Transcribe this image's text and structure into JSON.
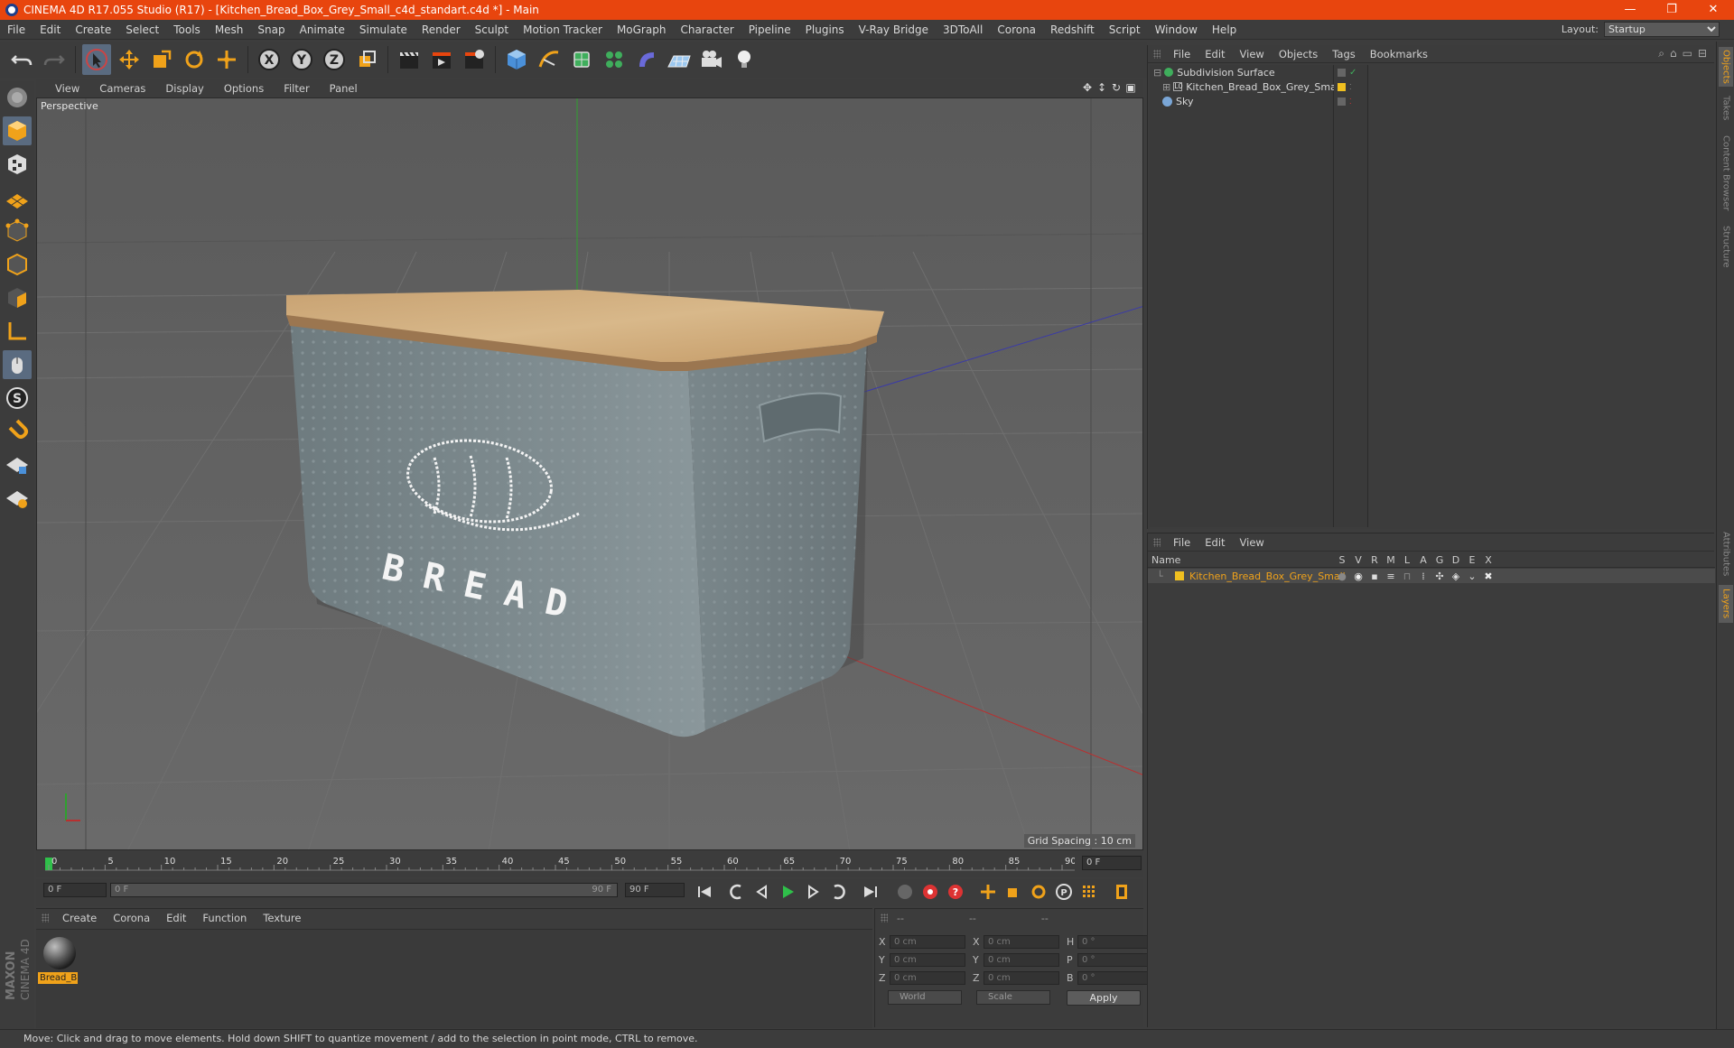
{
  "window": {
    "title": "CINEMA 4D R17.055 Studio (R17) - [Kitchen_Bread_Box_Grey_Small_c4d_standart.c4d *] - Main",
    "controls": [
      "—",
      "❐",
      "✕"
    ]
  },
  "menubar": {
    "items": [
      "File",
      "Edit",
      "Create",
      "Select",
      "Tools",
      "Mesh",
      "Snap",
      "Animate",
      "Simulate",
      "Render",
      "Sculpt",
      "Motion Tracker",
      "MoGraph",
      "Character",
      "Pipeline",
      "Plugins",
      "V-Ray Bridge",
      "3DToAll",
      "Corona",
      "Redshift",
      "Script",
      "Window",
      "Help"
    ],
    "layout_label": "Layout:",
    "layout_value": "Startup"
  },
  "viewport": {
    "menu": [
      "View",
      "Cameras",
      "Display",
      "Options",
      "Filter",
      "Panel"
    ],
    "label": "Perspective",
    "grid_spacing": "Grid Spacing : 10 cm",
    "model_text": "BREAD"
  },
  "timeline": {
    "ticks": [
      "0",
      "5",
      "10",
      "15",
      "20",
      "25",
      "30",
      "35",
      "40",
      "45",
      "50",
      "55",
      "60",
      "65",
      "70",
      "75",
      "80",
      "85",
      "90"
    ],
    "current_frame": "0 F",
    "start_field": "0 F",
    "scrub_start": "0 F",
    "scrub_end": "90 F",
    "end_field": "90 F"
  },
  "material_manager": {
    "menu": [
      "Create",
      "Corona",
      "Edit",
      "Function",
      "Texture"
    ],
    "materials": [
      {
        "name": "Bread_B"
      }
    ]
  },
  "coordinates": {
    "headers": [
      "--",
      "--",
      "--"
    ],
    "rows": [
      {
        "a": "X",
        "av": "0 cm",
        "b": "X",
        "bv": "0 cm",
        "c": "H",
        "cv": "0 °"
      },
      {
        "a": "Y",
        "av": "0 cm",
        "b": "Y",
        "bv": "0 cm",
        "c": "P",
        "cv": "0 °"
      },
      {
        "a": "Z",
        "av": "0 cm",
        "b": "Z",
        "bv": "0 cm",
        "c": "B",
        "cv": "0 °"
      }
    ],
    "space": "World",
    "mode": "Scale",
    "apply": "Apply"
  },
  "object_manager": {
    "menu": [
      "File",
      "Edit",
      "View",
      "Objects",
      "Tags",
      "Bookmarks"
    ],
    "objects": [
      {
        "name": "Subdivision Surface",
        "color": "#cfcfcf"
      },
      {
        "name": "Kitchen_Bread_Box_Grey_Small",
        "color": "#cfcfcf"
      },
      {
        "name": "Sky",
        "color": "#cfcfcf"
      }
    ]
  },
  "layer_manager": {
    "menu": [
      "File",
      "Edit",
      "View"
    ],
    "columns": [
      "Name",
      "S",
      "V",
      "R",
      "M",
      "L",
      "A",
      "G",
      "D",
      "E",
      "X"
    ],
    "layers": [
      {
        "name": "Kitchen_Bread_Box_Grey_Small",
        "color": "#f0c020"
      }
    ]
  },
  "side_tabs": [
    "Objects",
    "Takes",
    "Content Browser",
    "Structure",
    "Attributes",
    "Layers"
  ],
  "status": "Move: Click and drag to move elements. Hold down SHIFT to quantize movement / add to the selection in point mode, CTRL to remove.",
  "colors": {
    "accent": "#e8450e",
    "highlight": "#f0a21a",
    "panel": "#3c3c3c",
    "viewport": "#5f5f5f"
  }
}
